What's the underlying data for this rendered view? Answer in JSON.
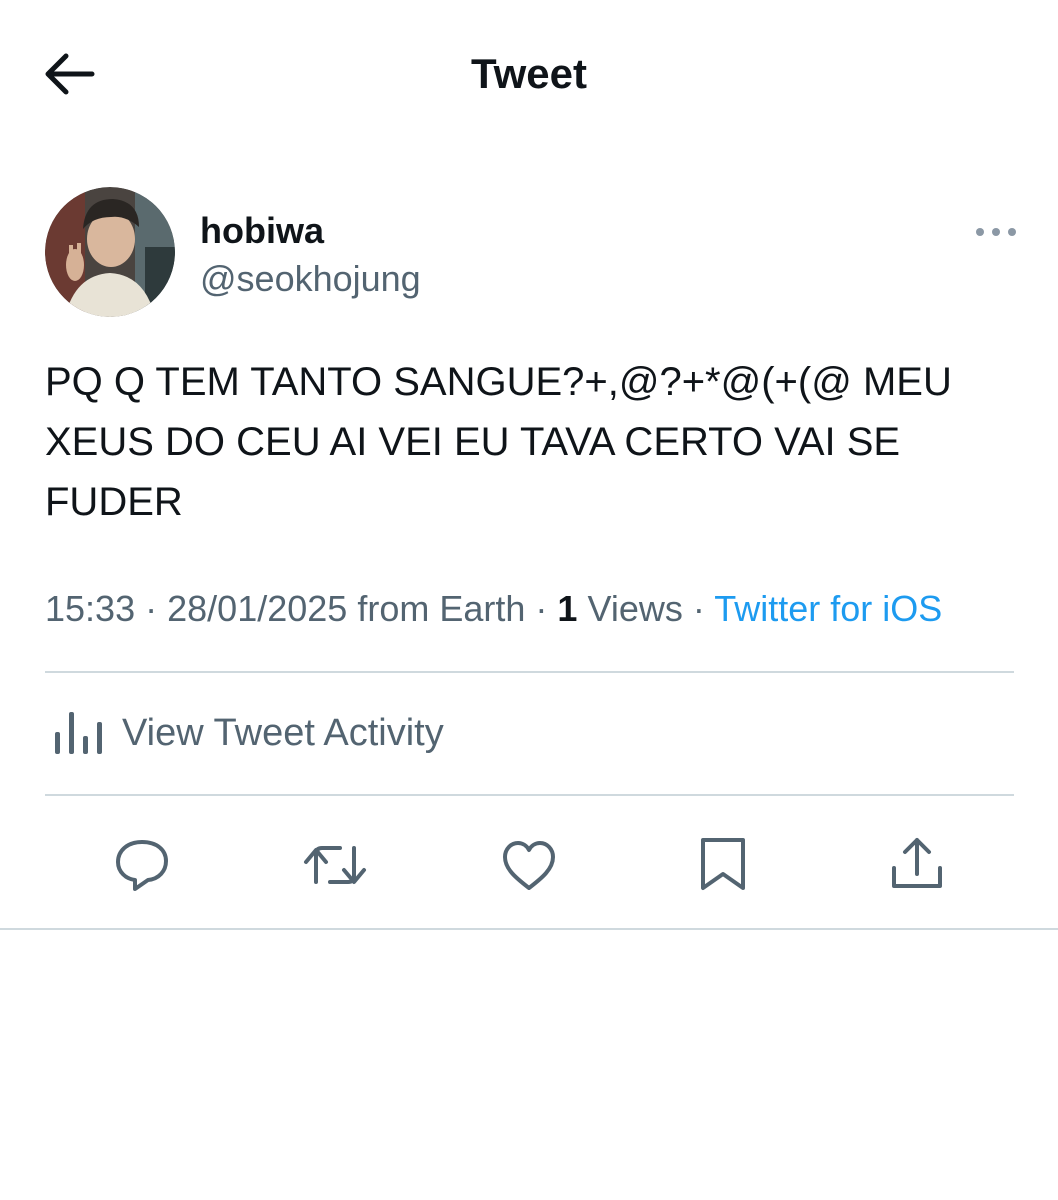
{
  "header": {
    "title": "Tweet",
    "back_icon": "arrow-left-icon"
  },
  "author": {
    "display_name": "hobiwa",
    "handle": "@seokhojung",
    "more_icon": "more-dots-icon"
  },
  "tweet": {
    "text": "PQ Q TEM TANTO SANGUE?+,@?+*@(+(@ MEU XEUS DO CEU AI VEI EU TAVA CERTO VAI SE FUDER"
  },
  "meta": {
    "time": "15:33",
    "date": "28/01/2025",
    "location": "from Earth",
    "views_count": "1",
    "views_label": "Views",
    "source": "Twitter for iOS",
    "separator": "·"
  },
  "activity": {
    "label": "View Tweet Activity",
    "icon": "analytics-icon"
  },
  "actions": [
    {
      "name": "reply",
      "icon": "reply-icon"
    },
    {
      "name": "retweet",
      "icon": "retweet-icon"
    },
    {
      "name": "like",
      "icon": "heart-icon"
    },
    {
      "name": "bookmark",
      "icon": "bookmark-icon"
    },
    {
      "name": "share",
      "icon": "share-icon"
    }
  ],
  "colors": {
    "text": "#0f1419",
    "secondary": "#536471",
    "link": "#1d9bf0",
    "divider": "#cfd9de"
  }
}
